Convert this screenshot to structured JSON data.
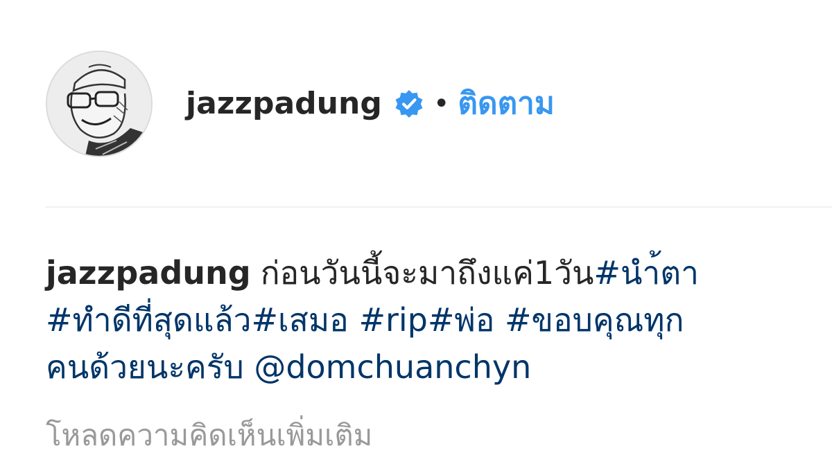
{
  "post": {
    "username": "jazzpadung",
    "separator": "•",
    "follow_label": "ติดตาม"
  },
  "caption": {
    "username": "jazzpadung",
    "line1": {
      "text": "ก่อนวันนี้จะมาถึงแค่1วัน",
      "tag1": "#นำ้ตา"
    },
    "line2": {
      "tag1": "#ทำดีที่สุดแล้ว",
      "tag2": "#เสมอ",
      "tag3": "#rip",
      "tag4": "#พ่อ",
      "tag5": "#ขอบคุณทุก"
    },
    "line3": {
      "tag_cont": "คนด้วยนะครับ",
      "mention": "@domchuanchyn"
    }
  },
  "load_more_label": "โหลดความคิดเห็นเพิ่มเติม",
  "colors": {
    "link_blue": "#3897f0",
    "tag_navy": "#003569",
    "muted_gray": "#999999",
    "text": "#262626"
  },
  "icons": {
    "avatar": "sketch-portrait-avatar",
    "verified": "verified-badge-icon"
  }
}
